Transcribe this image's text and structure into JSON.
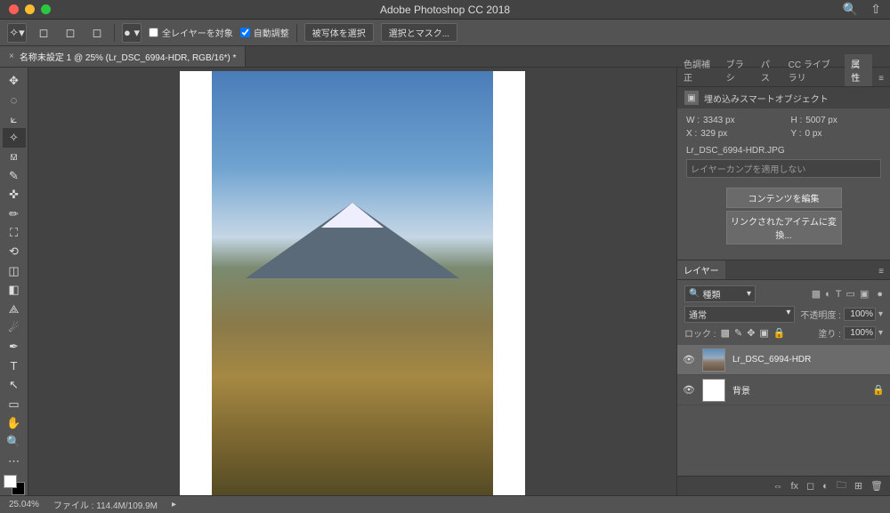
{
  "app_title": "Adobe Photoshop CC 2018",
  "optbar": {
    "all_layers": "全レイヤーを対象",
    "auto_adjust": "自動調整",
    "select_subject": "被写体を選択",
    "select_and_mask": "選択とマスク..."
  },
  "tab": {
    "close": "×",
    "title": "名称未設定 1 @ 25% (Lr_DSC_6994-HDR, RGB/16*) *"
  },
  "panel_tabs": {
    "color_correction": "色調補正",
    "brush": "ブラシ",
    "paths": "パス",
    "cc_libraries": "CC ライブラリ",
    "properties": "属性"
  },
  "properties": {
    "header": "埋め込みスマートオブジェクト",
    "w_label": "W :",
    "w_value": "3343 px",
    "h_label": "H :",
    "h_value": "5007 px",
    "x_label": "X :",
    "x_value": "329 px",
    "y_label": "Y :",
    "y_value": "0 px",
    "linked_file": "Lr_DSC_6994-HDR.JPG",
    "layer_comp": "レイヤーカンプを適用しない",
    "edit_contents": "コンテンツを編集",
    "convert_linked": "リンクされたアイテムに変換..."
  },
  "layers_panel": {
    "title": "レイヤー",
    "filter_kind": "種類",
    "blend_mode": "通常",
    "opacity_label": "不透明度 :",
    "opacity_value": "100%",
    "lock_label": "ロック :",
    "fill_label": "塗り :",
    "fill_value": "100%",
    "layers": [
      {
        "name": "Lr_DSC_6994-HDR",
        "locked": false
      },
      {
        "name": "背景",
        "locked": true
      }
    ]
  },
  "status": {
    "zoom": "25.04%",
    "file_info": "ファイル : 114.4M/109.9M"
  },
  "search_placeholder": "🔍種類"
}
